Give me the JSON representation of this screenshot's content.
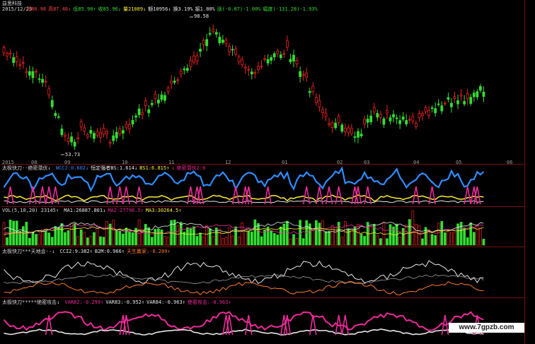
{
  "colors": {
    "background": "#000000",
    "grid": "#7a1010",
    "up": "#33dd33",
    "down": "#ee2222",
    "white": "#e8e8e8",
    "yellow": "#ffee33",
    "blue": "#2f8cff",
    "magenta": "#ee2a9a",
    "orange": "#ff7a2a"
  },
  "header": {
    "stock_name": "益思科技",
    "date": "2015/12/23",
    "ohlc_items": [
      {
        "text": "开86.98",
        "color": "#ff4444"
      },
      {
        "text": "高87.46↓",
        "color": "#ff4444"
      },
      {
        "text": "低85.90↑",
        "color": "#33dd33"
      },
      {
        "text": "收85.96↓",
        "color": "#33dd33"
      },
      {
        "text": "量21089↓",
        "color": "#ffee33"
      },
      {
        "text": "额10956↓",
        "color": "#e8e8e8"
      },
      {
        "text": "换3.19%",
        "color": "#e8e8e8"
      },
      {
        "text": "振1.80%",
        "color": "#e8e8e8"
      },
      {
        "text": "涨(-0.87)-1.00%",
        "color": "#33dd33"
      },
      {
        "text": "幅度(-131.28)-1.93%",
        "color": "#33dd33"
      }
    ]
  },
  "price_chart": {
    "high_label": "98.58",
    "low_label": "53.73",
    "x_axis_labels": [
      "2015",
      "08",
      "09",
      "10",
      "11",
      "12",
      "01",
      "02",
      "03",
      "04",
      "05",
      "06"
    ]
  },
  "indicator1": {
    "title": "太极快刀--绝密潜伏↓",
    "items": [
      {
        "text": "WCCJ:0.602↓",
        "color": "#2f8cff"
      },
      {
        "text": "恒定强者BS:1.614↓",
        "color": "#e8e8e8"
      },
      {
        "text": "BS1:6.815↑",
        "color": "#ffee33"
      },
      {
        "text": "↓",
        "color": "#ff4444"
      },
      {
        "text": "绝密潜伏2:0",
        "color": "#ee2a9a"
      }
    ]
  },
  "volume": {
    "title": "VOL(5,10,20) 23145↑",
    "items": [
      {
        "text": "MA1:26887.801↓",
        "color": "#e8e8e8"
      },
      {
        "text": "MA2:27796.5↑",
        "color": "#ee2a9a"
      },
      {
        "text": "MA3:30264.5↑",
        "color": "#ffee33"
      }
    ]
  },
  "indicator3": {
    "title": "太极快刀***天地会--↓",
    "items": [
      {
        "text": "CCI2:9.382↑",
        "color": "#e8e8e8"
      },
      {
        "text": "B2M:0.966↑",
        "color": "#e8e8e8"
      },
      {
        "text": "天生赢家:-0.209↑",
        "color": "#ff7a2a"
      }
    ]
  },
  "indicator4": {
    "title": "太极快刀*****绝密攻击↓",
    "items": [
      {
        "text": "VAR82:-0.299↑",
        "color": "#ee2a9a"
      },
      {
        "text": "VAR83:-0.952↑",
        "color": "#e8e8e8"
      },
      {
        "text": "VAR84:-0.963↑",
        "color": "#e8e8e8"
      },
      {
        "text": "绝密攻击:-0.963↑",
        "color": "#ee2a9a"
      }
    ]
  },
  "watermark": "www.7gpzb.com"
}
